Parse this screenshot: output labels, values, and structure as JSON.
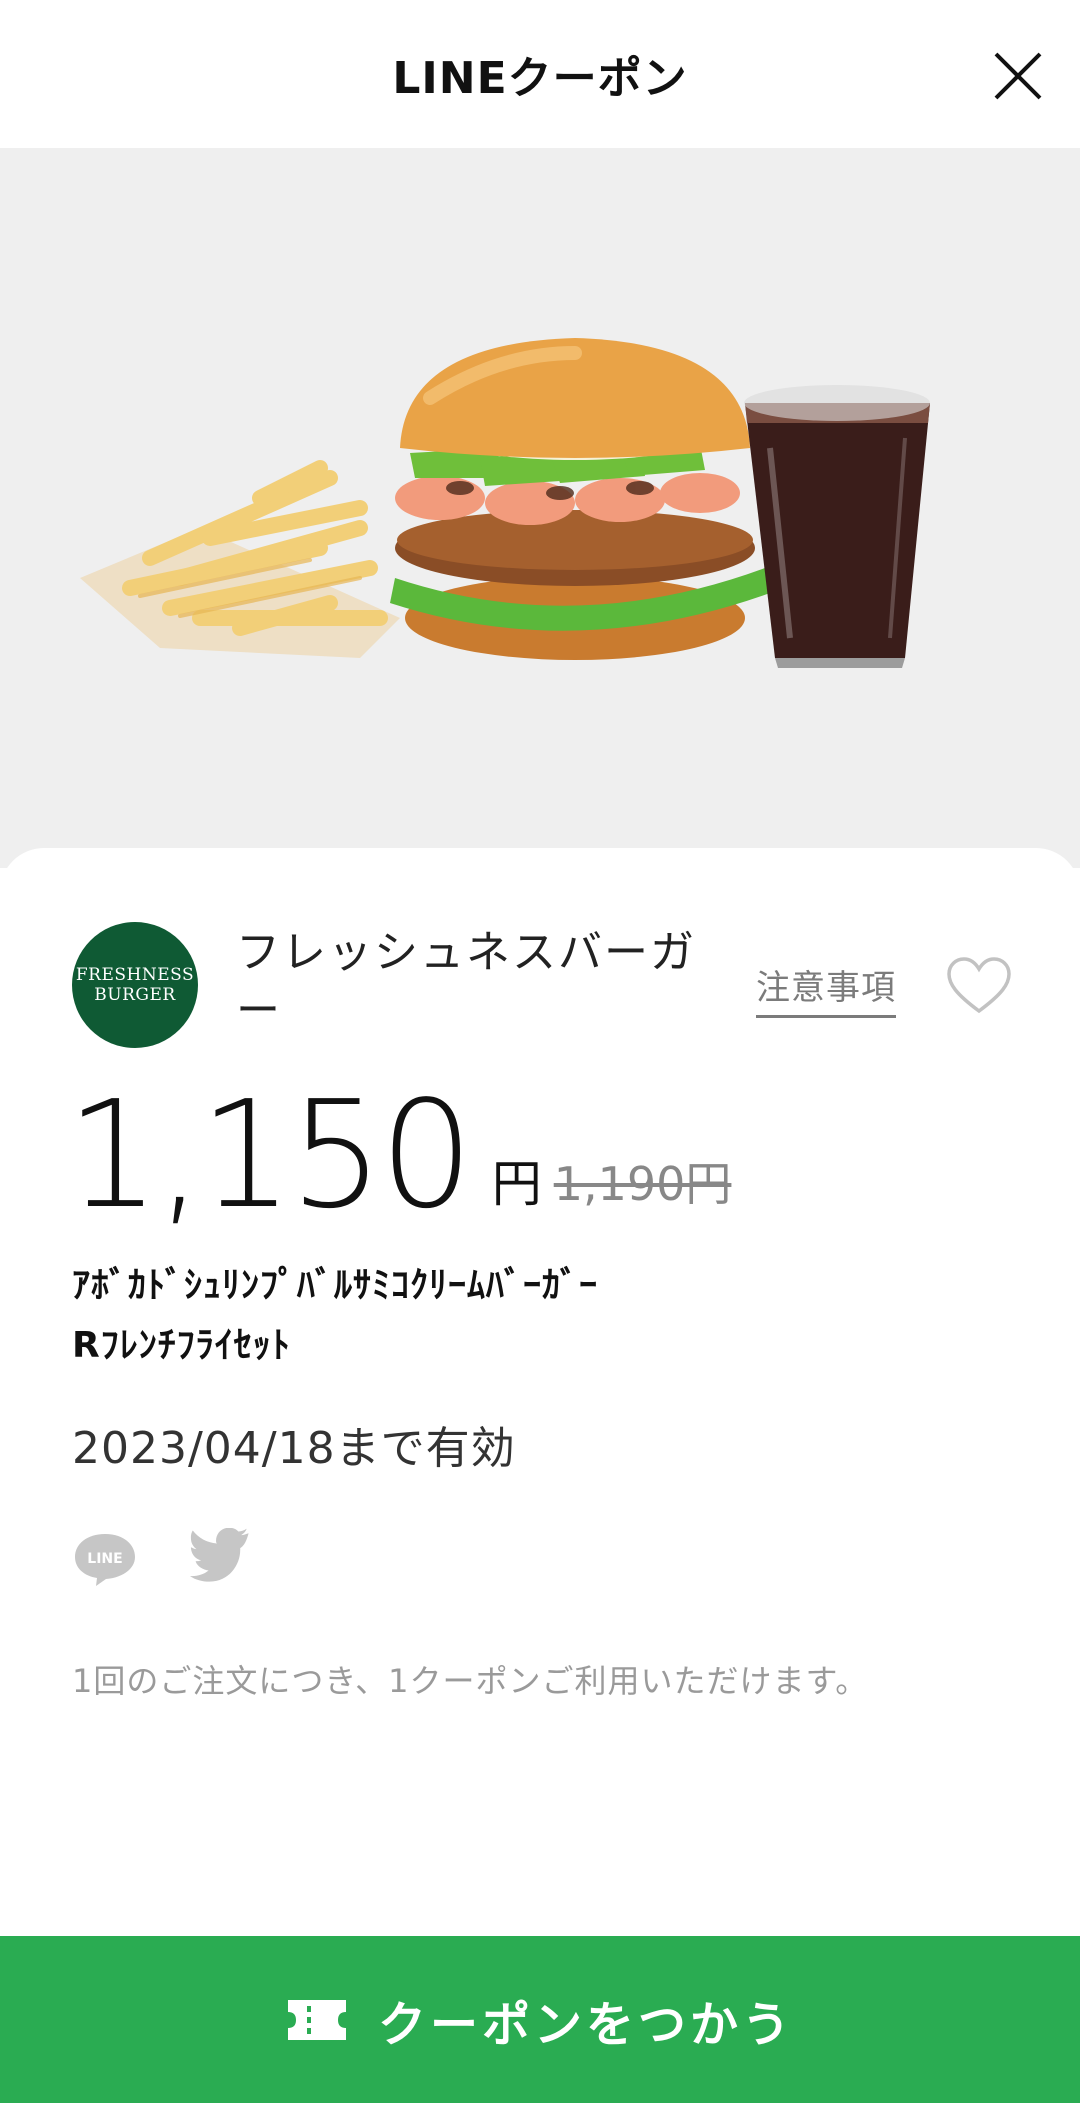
{
  "header": {
    "title": "LINEクーポン",
    "close_icon": "close-icon"
  },
  "hero": {
    "image_description": "burger-fries-cola-set"
  },
  "brand": {
    "logo_line1": "FRESHNESS",
    "logo_line2": "BURGER",
    "name": "フレッシュネスバーガー",
    "logo_color": "#0f5a34"
  },
  "notes_link": "注意事項",
  "price": {
    "value": "1,150",
    "unit": "円",
    "original": "1,190円"
  },
  "product": {
    "name_line1": "ｱﾎﾞｶﾄﾞｼｭﾘﾝﾌﾟﾊﾞﾙｻﾐｺｸﾘｰﾑﾊﾞｰｶﾞｰ",
    "name_line2": "Rﾌﾚﾝﾁﾌﾗｲｾｯﾄ"
  },
  "valid_until": "2023/04/18まで有効",
  "share": {
    "line_icon": "line-icon",
    "line_text": "LINE",
    "twitter_icon": "twitter-icon"
  },
  "usage_note": "1回のご注文につき、1クーポンご利用いただけます。",
  "use_button": {
    "label": "クーポンをつかう",
    "color": "#2aac52",
    "icon": "ticket-icon"
  }
}
